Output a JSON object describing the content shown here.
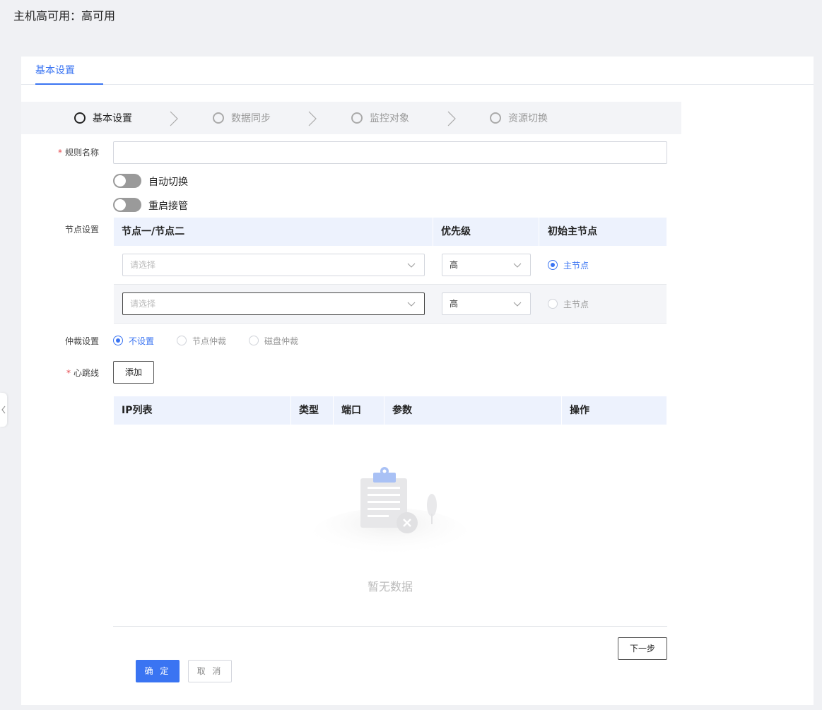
{
  "page": {
    "title": "主机高可用：高可用"
  },
  "tabs": [
    {
      "label": "基本设置",
      "active": true
    }
  ],
  "steps": [
    {
      "label": "基本设置",
      "active": true
    },
    {
      "label": "数据同步",
      "active": false
    },
    {
      "label": "监控对象",
      "active": false
    },
    {
      "label": "资源切换",
      "active": false
    }
  ],
  "form": {
    "rule_name": {
      "label": "规则名称",
      "required": true,
      "value": ""
    },
    "auto_switch": {
      "label": "自动切换",
      "on": false
    },
    "restart_takeover": {
      "label": "重启接管",
      "on": false
    },
    "node_settings": {
      "label": "节点设置",
      "columns": [
        "节点一/节点二",
        "优先级",
        "初始主节点"
      ],
      "rows": [
        {
          "node_placeholder": "请选择",
          "priority": "高",
          "primary_label": "主节点",
          "primary_selected": true
        },
        {
          "node_placeholder": "请选择",
          "priority": "高",
          "primary_label": "主节点",
          "primary_selected": false
        }
      ]
    },
    "arbitration": {
      "label": "仲裁设置",
      "options": [
        {
          "label": "不设置",
          "selected": true
        },
        {
          "label": "节点仲裁",
          "selected": false
        },
        {
          "label": "磁盘仲裁",
          "selected": false
        }
      ]
    },
    "heartbeat": {
      "label": "心跳线",
      "required": true,
      "add_label": "添加",
      "columns": [
        "IP列表",
        "类型",
        "端口",
        "参数",
        "操作"
      ],
      "empty_text": "暂无数据"
    }
  },
  "buttons": {
    "next": "下一步",
    "ok": "确 定",
    "cancel": "取 消"
  },
  "colors": {
    "accent": "#3a74f2",
    "required": "#e5484d",
    "header_bg": "#edf2fd"
  }
}
